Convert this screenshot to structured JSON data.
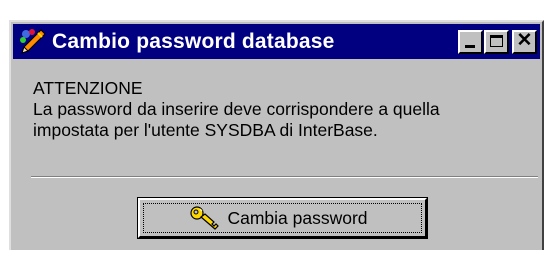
{
  "window": {
    "title": "Cambio password database",
    "icon": "pen-icon",
    "controls": {
      "minimize": "minimize-icon",
      "maximize": "maximize-icon",
      "close": "close-icon"
    }
  },
  "message": {
    "heading": "ATTENZIONE",
    "line1": "La password da inserire deve corrispondere a quella",
    "line2": "impostata per l'utente SYSDBA di InterBase."
  },
  "action": {
    "label": "Cambia password",
    "icon": "key-icon"
  },
  "colors": {
    "titlebar": "#000080",
    "face": "#c0c0c0"
  }
}
